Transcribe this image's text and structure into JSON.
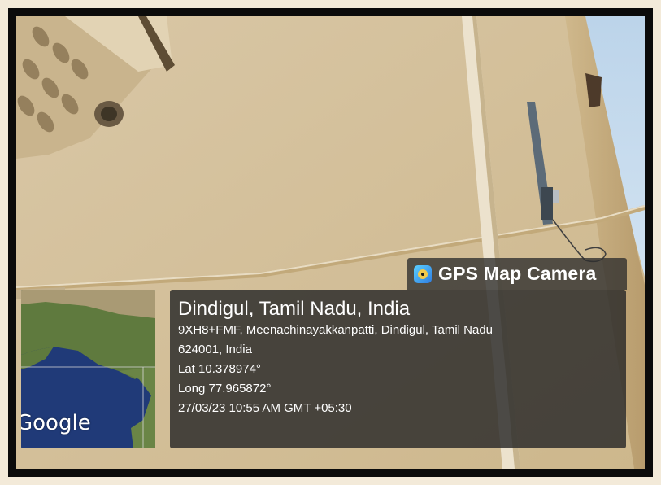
{
  "badge": {
    "icon": "camera-icon",
    "text": "GPS Map Camera"
  },
  "map": {
    "watermark": "Google"
  },
  "location": {
    "title": "Dindigul, Tamil Nadu, India",
    "address_line1": "9XH8+FMF, Meenachinayakkanpatti, Dindigul, Tamil Nadu",
    "address_line2": "624001, India",
    "lat": "Lat 10.378974°",
    "long": "Long 77.965872°",
    "timestamp": "27/03/23 10:55 AM GMT +05:30"
  },
  "colors": {
    "frame": "#0b0b0b",
    "border": "#f3ead9",
    "wall": "#dcc8a4",
    "sky": "#cfe3f3",
    "overlay": "#2d2d2d"
  }
}
